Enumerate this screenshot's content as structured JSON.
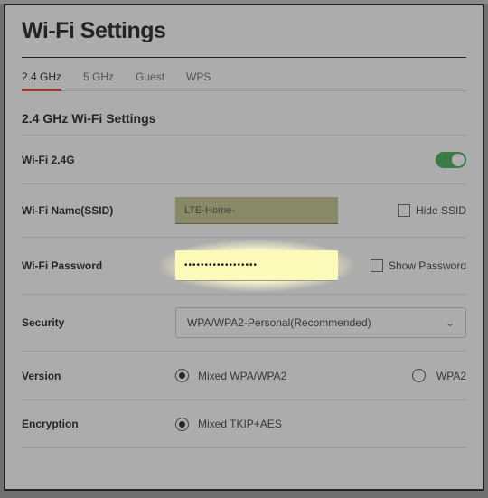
{
  "page_title": "Wi-Fi Settings",
  "tabs": {
    "t0": "2.4 GHz",
    "t1": "5 GHz",
    "t2": "Guest",
    "t3": "WPS"
  },
  "section_title": "2.4 GHz Wi-Fi Settings",
  "rows": {
    "wifi_enable_label": "Wi-Fi 2.4G",
    "ssid_label": "Wi-Fi Name(SSID)",
    "ssid_value": "LTE-Home-",
    "hide_ssid_label": "Hide SSID",
    "password_label": "Wi-Fi Password",
    "password_masked": "••••••••••••••••••",
    "show_password_label": "Show Password",
    "security_label": "Security",
    "security_value": "WPA/WPA2-Personal(Recommended)",
    "version_label": "Version",
    "version_opt1": "Mixed WPA/WPA2",
    "version_opt2": "WPA2",
    "encryption_label": "Encryption",
    "encryption_opt1": "Mixed TKIP+AES"
  }
}
